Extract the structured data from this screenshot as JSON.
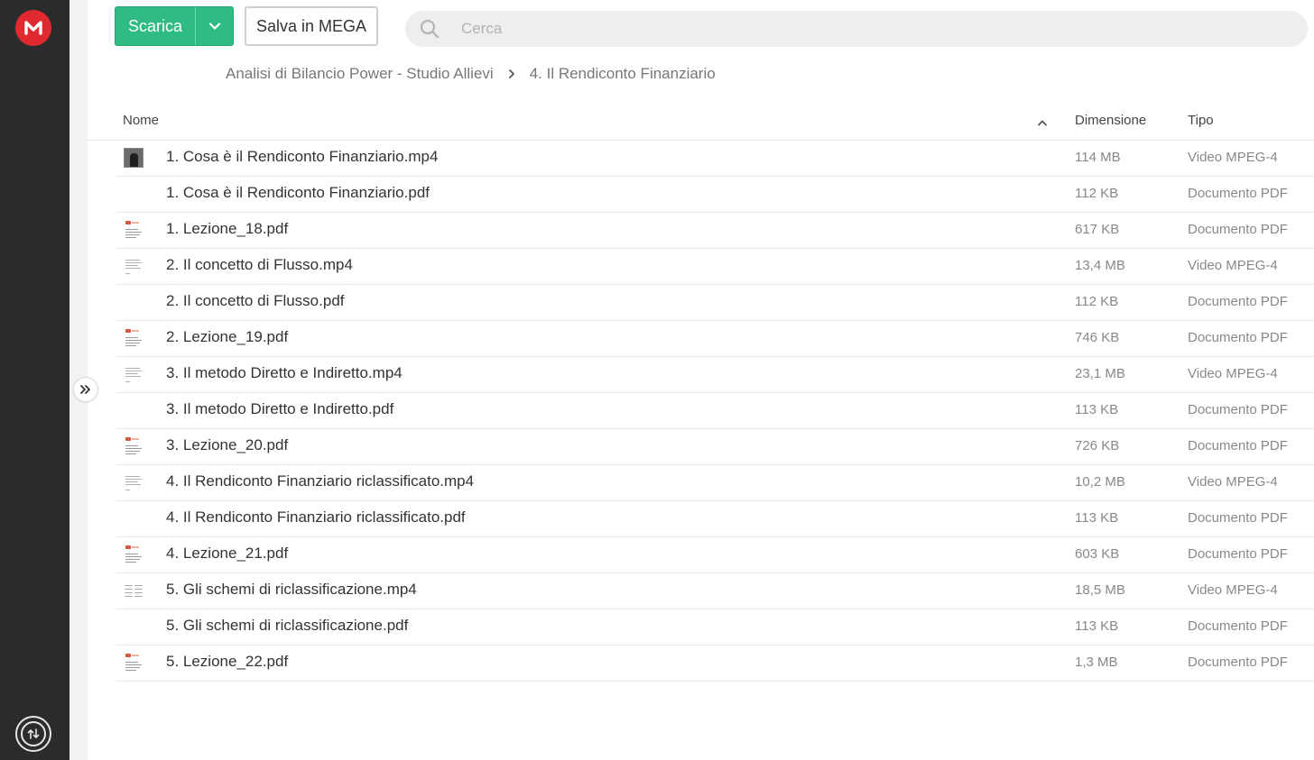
{
  "toolbar": {
    "download_label": "Scarica",
    "save_label": "Salva in MEGA",
    "search_placeholder": "Cerca"
  },
  "breadcrumb": {
    "parent": "Analisi di Bilancio Power - Studio Allievi",
    "current": "4. Il Rendiconto Finanziario"
  },
  "table": {
    "headers": {
      "name": "Nome",
      "size": "Dimensione",
      "type": "Tipo"
    },
    "rows": [
      {
        "name": "1. Cosa è il Rendiconto Finanziario.mp4",
        "size": "114 MB",
        "type": "Video MPEG-4",
        "thumb": "video-photo"
      },
      {
        "name": "1. Cosa è il Rendiconto Finanziario.pdf",
        "size": "112 KB",
        "type": "Documento PDF",
        "thumb": "none"
      },
      {
        "name": "1. Lezione_18.pdf",
        "size": "617 KB",
        "type": "Documento PDF",
        "thumb": "doc"
      },
      {
        "name": "2. Il concetto di Flusso.mp4",
        "size": "13,4 MB",
        "type": "Video MPEG-4",
        "thumb": "slide"
      },
      {
        "name": "2. Il concetto di Flusso.pdf",
        "size": "112 KB",
        "type": "Documento PDF",
        "thumb": "none"
      },
      {
        "name": "2. Lezione_19.pdf",
        "size": "746 KB",
        "type": "Documento PDF",
        "thumb": "doc"
      },
      {
        "name": "3. Il metodo Diretto e Indiretto.mp4",
        "size": "23,1 MB",
        "type": "Video MPEG-4",
        "thumb": "slide"
      },
      {
        "name": "3. Il metodo Diretto e Indiretto.pdf",
        "size": "113 KB",
        "type": "Documento PDF",
        "thumb": "none"
      },
      {
        "name": "3. Lezione_20.pdf",
        "size": "726 KB",
        "type": "Documento PDF",
        "thumb": "doc"
      },
      {
        "name": "4. Il Rendiconto Finanziario riclassificato.mp4",
        "size": "10,2 MB",
        "type": "Video MPEG-4",
        "thumb": "slide"
      },
      {
        "name": "4. Il Rendiconto Finanziario riclassificato.pdf",
        "size": "113 KB",
        "type": "Documento PDF",
        "thumb": "none"
      },
      {
        "name": "4. Lezione_21.pdf",
        "size": "603 KB",
        "type": "Documento PDF",
        "thumb": "doc"
      },
      {
        "name": "5. Gli schemi di riclassificazione.mp4",
        "size": "18,5 MB",
        "type": "Video MPEG-4",
        "thumb": "table"
      },
      {
        "name": "5. Gli schemi di riclassificazione.pdf",
        "size": "113 KB",
        "type": "Documento PDF",
        "thumb": "none"
      },
      {
        "name": "5. Lezione_22.pdf",
        "size": "1,3 MB",
        "type": "Documento PDF",
        "thumb": "doc"
      }
    ]
  },
  "icons": {
    "logo": "mega-logo-icon",
    "transfers": "transfer-manager-icon",
    "expand": "double-chevron-right-icon",
    "search": "search-icon",
    "sort": "chevron-up-icon",
    "caret": "chevron-down-icon"
  },
  "colors": {
    "brand_red": "#e02a2f",
    "download_green": "#2ebc82",
    "rail_dark": "#2b2b2b"
  }
}
